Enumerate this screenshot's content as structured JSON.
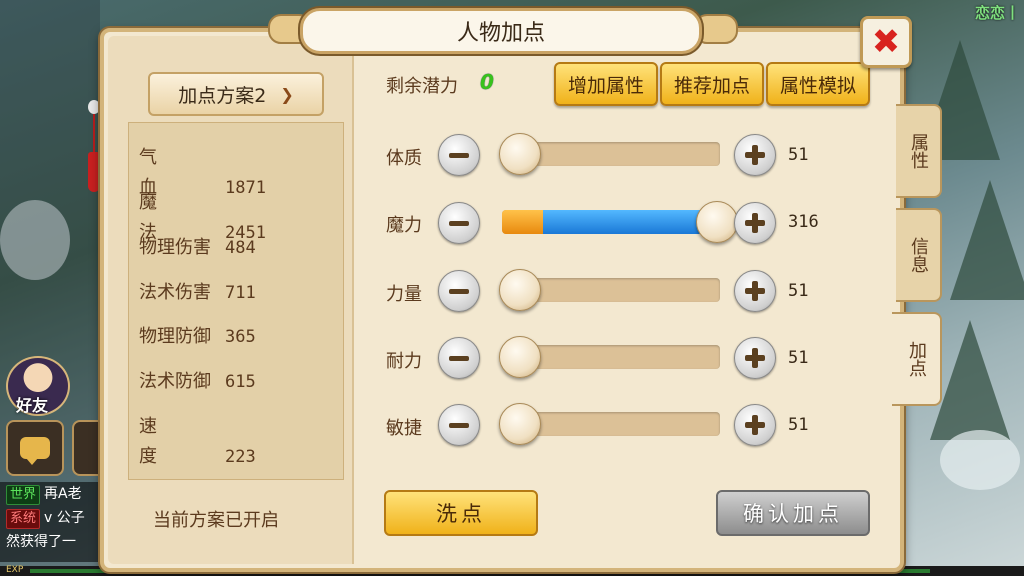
{
  "window": {
    "title": "人物加点",
    "corner_text": "恋恋丨"
  },
  "left_panel": {
    "scheme_label": "加点方案2",
    "stats": [
      {
        "name": "气血",
        "value": "1871"
      },
      {
        "name": "魔法",
        "value": "2451"
      },
      {
        "name": "物理伤害",
        "value": "484"
      },
      {
        "name": "法术伤害",
        "value": "711"
      },
      {
        "name": "物理防御",
        "value": "365"
      },
      {
        "name": "法术防御",
        "value": "615"
      },
      {
        "name": "速度",
        "value": "223"
      }
    ],
    "status_text": "当前方案已开启"
  },
  "right_panel": {
    "potential_label": "剩余潜力",
    "potential_value": "0",
    "buttons": {
      "add_attr": "增加属性",
      "recommend": "推荐加点",
      "simulate": "属性模拟"
    },
    "attributes": [
      {
        "name": "体质",
        "value": "51",
        "base_fraction": 0.08,
        "extra_fraction": 0.0
      },
      {
        "name": "魔力",
        "value": "316",
        "base_fraction": 0.19,
        "extra_fraction": 0.82
      },
      {
        "name": "力量",
        "value": "51",
        "base_fraction": 0.08,
        "extra_fraction": 0.0
      },
      {
        "name": "耐力",
        "value": "51",
        "base_fraction": 0.08,
        "extra_fraction": 0.0
      },
      {
        "name": "敏捷",
        "value": "51",
        "base_fraction": 0.08,
        "extra_fraction": 0.0
      }
    ],
    "wash_label": "洗点",
    "confirm_label": "确认加点"
  },
  "side_tabs": [
    "属性",
    "信息",
    "加点"
  ],
  "active_tab": "加点",
  "hud": {
    "friend_label": "好友",
    "chat": [
      {
        "tag": "世界",
        "text": "再A老"
      },
      {
        "tag": "系统",
        "text": "v 公子"
      },
      {
        "tag": "",
        "text": "然获得了一"
      }
    ],
    "exp_label": "EXP"
  },
  "colors": {
    "potential_green": "#38c21c",
    "close_red": "#d8231f",
    "slider_orange": "#f0a020",
    "slider_blue": "#2a8ae8"
  }
}
